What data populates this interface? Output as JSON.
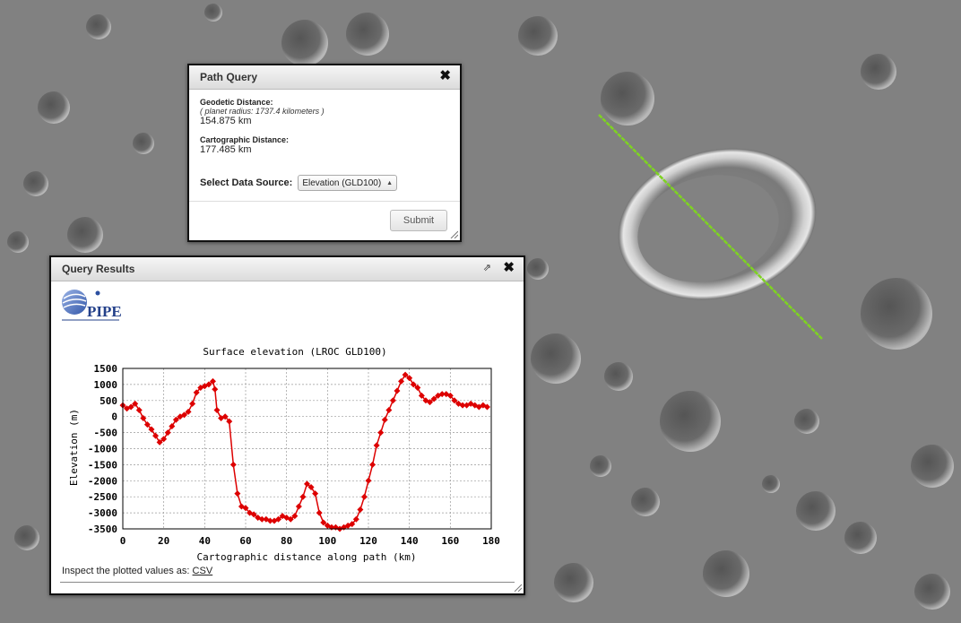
{
  "path_query": {
    "title": "Path Query",
    "close_glyph": "✖",
    "geodetic_label": "Geodetic Distance:",
    "planet_radius_note": "( planet radius: 1737.4 kilometers )",
    "geodetic_value": "154.875 km",
    "cartographic_label": "Cartographic Distance:",
    "cartographic_value": "177.485 km",
    "data_source_label": "Select Data Source:",
    "data_source_selected": "Elevation (GLD100)",
    "submit_label": "Submit"
  },
  "query_results": {
    "title": "Query Results",
    "close_glyph": "✖",
    "popout_glyph": "⇗",
    "logo_text": "PIPE",
    "inspect_text": "Inspect the plotted values as:",
    "csv_link": "CSV"
  },
  "colors": {
    "series": "#dd0000",
    "path_line": "#7ed321"
  },
  "chart_data": {
    "type": "line",
    "title": "Surface elevation (LROC GLD100)",
    "xlabel": "Cartographic distance along path (km)",
    "ylabel": "Elevation (m)",
    "xlim": [
      0,
      180
    ],
    "ylim": [
      -3500,
      1500
    ],
    "xticks": [
      0,
      20,
      40,
      60,
      80,
      100,
      120,
      140,
      160,
      180
    ],
    "yticks": [
      1500,
      1000,
      500,
      0,
      -500,
      -1000,
      -1500,
      -2000,
      -2500,
      -3000,
      -3500
    ],
    "grid": true,
    "series": [
      {
        "x": [
          0,
          2,
          4,
          6,
          8,
          10,
          12,
          14,
          16,
          18,
          20,
          22,
          24,
          26,
          28,
          30,
          32,
          34,
          36,
          38,
          40,
          42,
          44,
          45,
          46,
          48,
          50,
          52,
          54,
          56,
          58,
          60,
          62,
          64,
          66,
          68,
          70,
          72,
          74,
          76,
          78,
          80,
          82,
          84,
          86,
          88,
          90,
          92,
          94,
          96,
          98,
          100,
          102,
          104,
          106,
          108,
          110,
          112,
          114,
          116,
          118,
          120,
          122,
          124,
          126,
          128,
          130,
          132,
          134,
          136,
          138,
          140,
          142,
          144,
          146,
          148,
          150,
          152,
          154,
          156,
          158,
          160,
          162,
          164,
          166,
          168,
          170,
          172,
          174,
          176,
          178
        ],
        "y": [
          350,
          250,
          300,
          400,
          200,
          -50,
          -250,
          -400,
          -600,
          -800,
          -700,
          -500,
          -300,
          -100,
          0,
          50,
          150,
          400,
          750,
          900,
          950,
          1000,
          1100,
          850,
          200,
          -50,
          0,
          -150,
          -1500,
          -2400,
          -2800,
          -2850,
          -3000,
          -3050,
          -3150,
          -3200,
          -3200,
          -3250,
          -3250,
          -3200,
          -3100,
          -3150,
          -3200,
          -3100,
          -2800,
          -2500,
          -2100,
          -2200,
          -2400,
          -3000,
          -3300,
          -3400,
          -3450,
          -3450,
          -3500,
          -3450,
          -3400,
          -3350,
          -3200,
          -2900,
          -2500,
          -2000,
          -1500,
          -900,
          -500,
          -100,
          200,
          500,
          800,
          1100,
          1300,
          1200,
          1000,
          900,
          650,
          500,
          450,
          550,
          650,
          700,
          700,
          650,
          500,
          400,
          350,
          350,
          400,
          350,
          300,
          350,
          300
        ]
      }
    ]
  }
}
